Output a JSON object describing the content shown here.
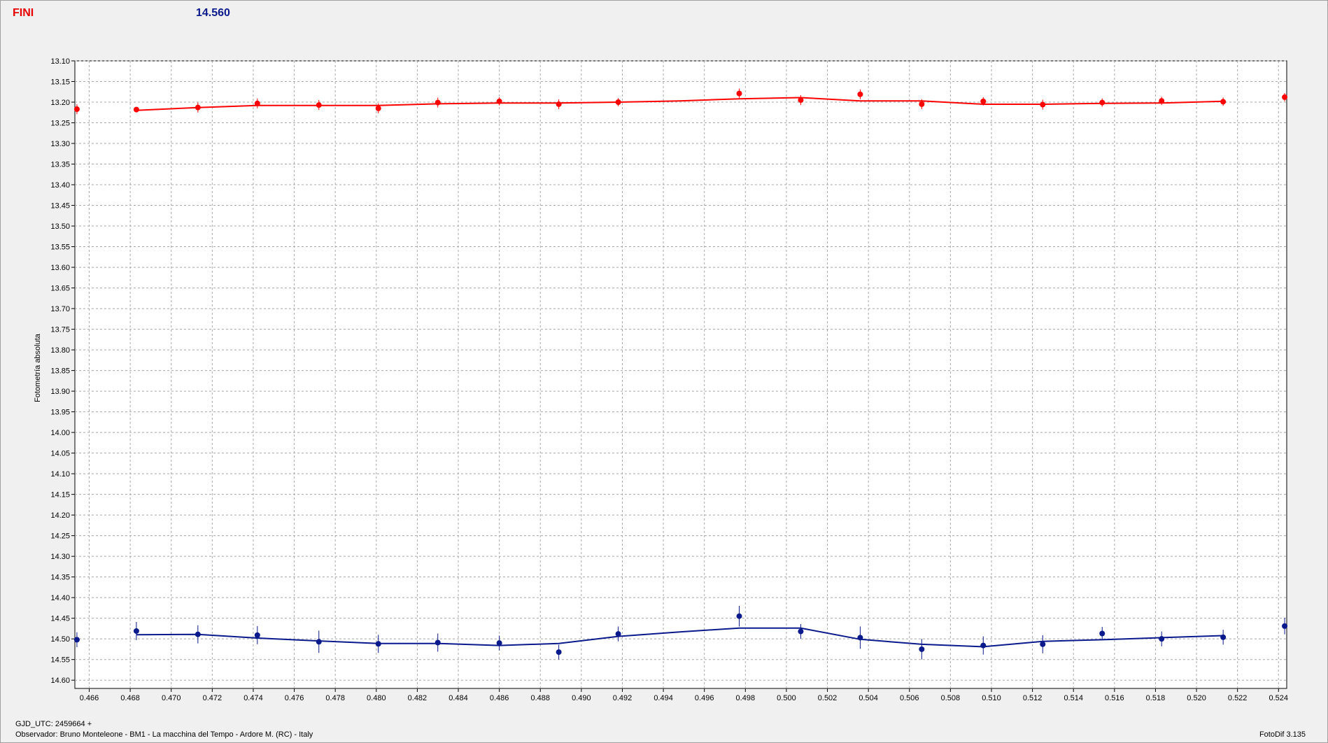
{
  "header": {
    "left_label": "FINI",
    "left_color": "#e60000",
    "right_label": "14.560",
    "right_color": "#0a1a8c"
  },
  "footer": {
    "gjd": "GJD_UTC: 2459664 +",
    "observer": "Observador: Bruno Monteleone - BM1 - La macchina del Tempo - Ardore M. (RC) - Italy",
    "version": "FotoDif 3.135"
  },
  "chart_data": {
    "type": "scatter",
    "ylabel": "Fotometría absoluta",
    "xlabel": "",
    "xlim": [
      0.4653,
      0.5244
    ],
    "ylim": [
      13.1,
      14.62
    ],
    "y_inverted": true,
    "grid": true,
    "x_ticks": [
      "0.466",
      "0.468",
      "0.470",
      "0.472",
      "0.474",
      "0.476",
      "0.478",
      "0.480",
      "0.482",
      "0.484",
      "0.486",
      "0.488",
      "0.490",
      "0.492",
      "0.494",
      "0.496",
      "0.498",
      "0.500",
      "0.502",
      "0.504",
      "0.506",
      "0.508",
      "0.510",
      "0.512",
      "0.514",
      "0.516",
      "0.518",
      "0.520",
      "0.522",
      "0.524"
    ],
    "y_ticks": [
      "13.10",
      "13.15",
      "13.20",
      "13.25",
      "13.30",
      "13.35",
      "13.40",
      "13.45",
      "13.50",
      "13.55",
      "13.60",
      "13.65",
      "13.70",
      "13.75",
      "13.80",
      "13.85",
      "13.90",
      "13.95",
      "14.00",
      "14.05",
      "14.10",
      "14.15",
      "14.20",
      "14.25",
      "14.30",
      "14.35",
      "14.40",
      "14.45",
      "14.50",
      "14.55",
      "14.60"
    ],
    "series": [
      {
        "color": "#ff0000",
        "x": [
          0.4654,
          0.4683,
          0.4713,
          0.4742,
          0.4772,
          0.4801,
          0.483,
          0.486,
          0.4889,
          0.4918,
          0.4977,
          0.5007,
          0.5036,
          0.5066,
          0.5096,
          0.5125,
          0.5154,
          0.5183,
          0.5213,
          0.5243
        ],
        "y": [
          13.217,
          13.218,
          13.213,
          13.203,
          13.207,
          13.215,
          13.201,
          13.198,
          13.205,
          13.2,
          13.179,
          13.195,
          13.181,
          13.205,
          13.198,
          13.206,
          13.201,
          13.197,
          13.199,
          13.188
        ],
        "err": [
          0.012,
          0.006,
          0.012,
          0.012,
          0.012,
          0.012,
          0.012,
          0.01,
          0.012,
          0.01,
          0.012,
          0.012,
          0.012,
          0.012,
          0.01,
          0.012,
          0.01,
          0.01,
          0.01,
          0.01
        ],
        "fit_x": [
          0.4683,
          0.4713,
          0.4742,
          0.4772,
          0.4801,
          0.483,
          0.486,
          0.4889,
          0.4918,
          0.4948,
          0.4977,
          0.5007,
          0.5036,
          0.5066,
          0.5096,
          0.5125,
          0.5154,
          0.5183,
          0.5213
        ],
        "fit_y": [
          13.22,
          13.213,
          13.208,
          13.208,
          13.208,
          13.204,
          13.202,
          13.202,
          13.2,
          13.197,
          13.192,
          13.189,
          13.197,
          13.197,
          13.205,
          13.205,
          13.203,
          13.202,
          13.198
        ]
      },
      {
        "color": "#0a1a8c",
        "x": [
          0.4654,
          0.4683,
          0.4713,
          0.4742,
          0.4772,
          0.4801,
          0.483,
          0.486,
          0.4889,
          0.4918,
          0.4977,
          0.5007,
          0.5036,
          0.5066,
          0.5096,
          0.5125,
          0.5154,
          0.5183,
          0.5213,
          0.5243
        ],
        "y": [
          14.502,
          14.481,
          14.489,
          14.491,
          14.507,
          14.512,
          14.509,
          14.51,
          14.532,
          14.488,
          14.445,
          14.482,
          14.497,
          14.525,
          14.516,
          14.513,
          14.487,
          14.5,
          14.496,
          14.469
        ],
        "err": [
          0.018,
          0.022,
          0.022,
          0.022,
          0.027,
          0.022,
          0.022,
          0.018,
          0.018,
          0.018,
          0.025,
          0.018,
          0.027,
          0.025,
          0.022,
          0.022,
          0.016,
          0.018,
          0.018,
          0.02
        ],
        "fit_x": [
          0.4683,
          0.4713,
          0.4742,
          0.4772,
          0.4801,
          0.483,
          0.486,
          0.4889,
          0.4918,
          0.4948,
          0.4977,
          0.5007,
          0.5036,
          0.5066,
          0.5096,
          0.5125,
          0.5154,
          0.5183,
          0.5213
        ],
        "fit_y": [
          14.49,
          14.489,
          14.498,
          14.505,
          14.511,
          14.511,
          14.516,
          14.511,
          14.494,
          14.483,
          14.474,
          14.474,
          14.501,
          14.513,
          14.519,
          14.506,
          14.502,
          14.497,
          14.492
        ]
      }
    ]
  }
}
